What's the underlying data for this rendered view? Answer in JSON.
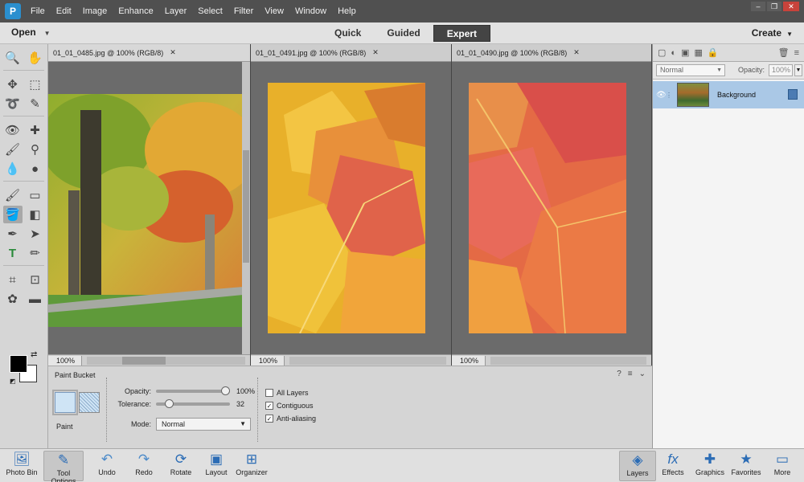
{
  "app": {
    "menu": [
      "File",
      "Edit",
      "Image",
      "Enhance",
      "Layer",
      "Select",
      "Filter",
      "View",
      "Window",
      "Help"
    ],
    "window_controls": [
      "–",
      "❐",
      "✕"
    ]
  },
  "modebar": {
    "open_label": "Open",
    "tabs": [
      {
        "label": "Quick",
        "active": false
      },
      {
        "label": "Guided",
        "active": false
      },
      {
        "label": "Expert",
        "active": true
      }
    ],
    "create_label": "Create"
  },
  "toolbox": {
    "groups": [
      [
        "zoom-tool",
        "hand-tool"
      ],
      [
        "move-tool",
        "marquee-tool",
        "lasso-tool",
        "quick-selection-tool"
      ],
      [
        "red-eye-tool",
        "spot-healing-tool",
        "smart-brush-tool",
        "clone-stamp-tool",
        "blur-tool",
        "sponge-tool"
      ],
      [
        "brush-tool",
        "eraser-tool",
        "paint-bucket-tool",
        "gradient-tool",
        "eyedropper-tool",
        "custom-shape-tool",
        "type-tool",
        "pencil-tool"
      ],
      [
        "crop-tool",
        "recompose-tool",
        "cookie-cutter-tool",
        "straighten-tool"
      ]
    ],
    "active_tool": "paint-bucket-tool",
    "foreground_color": "#000000",
    "background_color": "#ffffff"
  },
  "documents": [
    {
      "tab": "01_01_0485.jpg @ 100% (RGB/8)",
      "zoom": "100%",
      "active": true
    },
    {
      "tab": "01_01_0491.jpg @ 100% (RGB/8)",
      "zoom": "100%",
      "active": false
    },
    {
      "tab": "01_01_0490.jpg @ 100% (RGB/8)",
      "zoom": "100%",
      "active": false
    }
  ],
  "tool_options": {
    "title": "Paint Bucket",
    "paint_label": "Paint",
    "opacity_label": "Opacity:",
    "opacity_value": "100%",
    "opacity_fraction": 1.0,
    "tolerance_label": "Tolerance:",
    "tolerance_value": "32",
    "tolerance_fraction": 0.13,
    "mode_label": "Mode:",
    "mode_value": "Normal",
    "checkboxes": [
      {
        "label": "All Layers",
        "checked": false
      },
      {
        "label": "Contiguous",
        "checked": true
      },
      {
        "label": "Anti-aliasing",
        "checked": true
      }
    ]
  },
  "layers_panel": {
    "blend_mode": "Normal",
    "opacity_label": "Opacity:",
    "opacity_value": "100%",
    "layers": [
      {
        "name": "Background",
        "selected": true
      }
    ]
  },
  "taskbar": {
    "left": [
      {
        "label": "Photo Bin",
        "icon": "photo-bin-icon",
        "active": false
      },
      {
        "label": "Tool Options",
        "icon": "tool-options-icon",
        "active": true
      },
      {
        "label": "Undo",
        "icon": "undo-icon",
        "active": false
      },
      {
        "label": "Redo",
        "icon": "redo-icon",
        "active": false
      },
      {
        "label": "Rotate",
        "icon": "rotate-icon",
        "active": false
      },
      {
        "label": "Layout",
        "icon": "layout-icon",
        "active": false
      },
      {
        "label": "Organizer",
        "icon": "organizer-icon",
        "active": false
      }
    ],
    "right": [
      {
        "label": "Layers",
        "icon": "layers-icon",
        "active": true
      },
      {
        "label": "Effects",
        "icon": "effects-icon",
        "active": false
      },
      {
        "label": "Graphics",
        "icon": "graphics-icon",
        "active": false
      },
      {
        "label": "Favorites",
        "icon": "favorites-icon",
        "active": false
      },
      {
        "label": "More",
        "icon": "more-icon",
        "active": false
      }
    ]
  }
}
